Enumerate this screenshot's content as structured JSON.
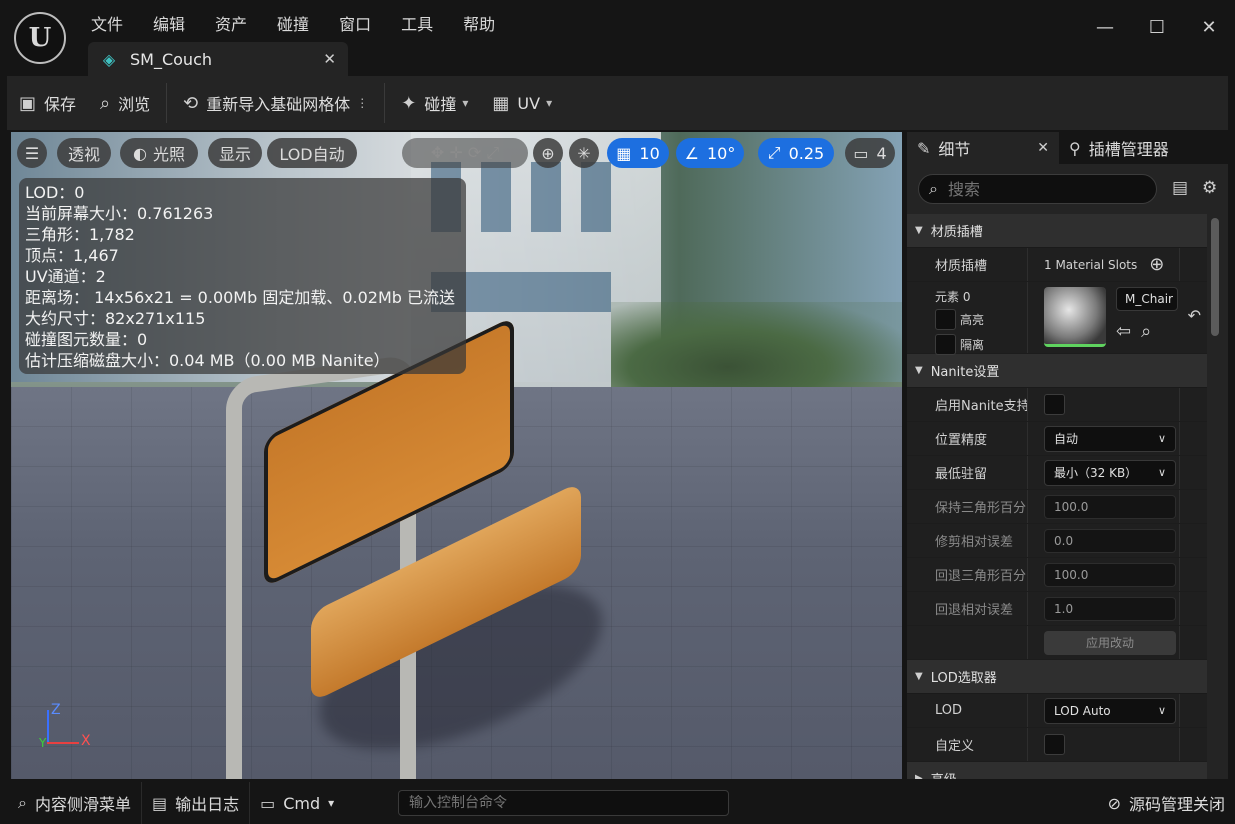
{
  "menu": [
    "文件",
    "编辑",
    "资产",
    "碰撞",
    "窗口",
    "工具",
    "帮助"
  ],
  "document_tab": {
    "label": "SM_Couch"
  },
  "toolbar": {
    "save": "保存",
    "browse": "浏览",
    "reimport": "重新导入基础网格体",
    "collision": "碰撞",
    "uv": "UV"
  },
  "viewport": {
    "perspective": "透视",
    "lighting": "光照",
    "show": "显示",
    "lod": "LOD自动",
    "grid_snap": "10",
    "rotate_snap": "10°",
    "scale_snap": "0.25",
    "camera_speed": "4",
    "stats": [
      "LOD：0",
      "当前屏幕大小：0.761263",
      "三角形：1,782",
      "顶点：1,467",
      "UV通道：2",
      "距离场： 14x56x21 = 0.00Mb 固定加载、0.02Mb 已流送",
      "大约尺寸：82x271x115",
      "碰撞图元数量：0",
      "估计压缩磁盘大小：0.04 MB（0.00 MB Nanite）"
    ],
    "axis": {
      "z": "Z",
      "x": "X",
      "y": "Y"
    }
  },
  "details": {
    "tab_details": "细节",
    "tab_sockets": "插槽管理器",
    "search_placeholder": "搜索",
    "material_category": "材质插槽",
    "material_slots_label": "材质插槽",
    "material_slots_value": "1 Material Slots",
    "element_label": "元素 0",
    "highlight": "高亮",
    "isolate": "隔离",
    "material_name": "M_Chair",
    "nanite_category": "Nanite设置",
    "enable_nanite": "启用Nanite支持",
    "position_precision": "位置精度",
    "position_precision_value": "自动",
    "min_resident": "最低驻留",
    "min_resident_value": "最小（32 KB）",
    "keep_triangle": "保持三角形百分",
    "keep_triangle_value": "100.0",
    "trim_error": "修剪相对误差",
    "trim_error_value": "0.0",
    "fallback_triangle": "回退三角形百分",
    "fallback_triangle_value": "100.0",
    "fallback_error": "回退相对误差",
    "fallback_error_value": "1.0",
    "apply": "应用改动",
    "lod_category": "LOD选取器",
    "lod_label": "LOD",
    "lod_value": "LOD Auto",
    "custom": "自定义",
    "advanced": "高级"
  },
  "statusbar": {
    "content_drawer": "内容侧滑菜单",
    "output_log": "输出日志",
    "cmd": "Cmd",
    "console_placeholder": "输入控制台命令",
    "source_control": "源码管理关闭"
  }
}
